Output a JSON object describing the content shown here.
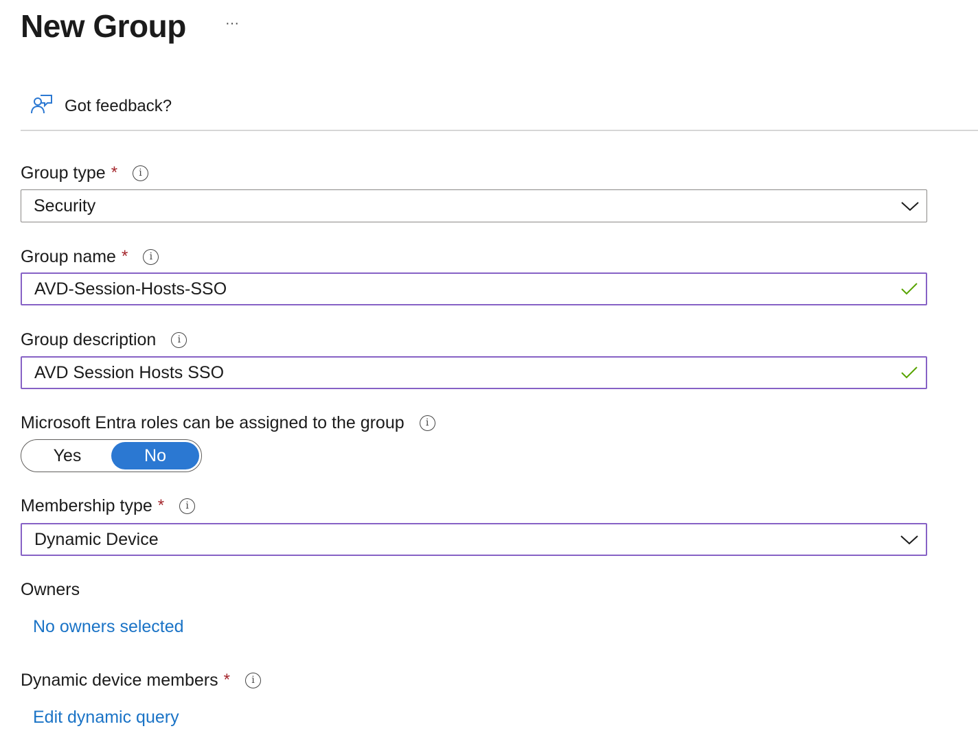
{
  "header": {
    "title": "New Group",
    "more_label": "···"
  },
  "toolbar": {
    "feedback_label": "Got feedback?"
  },
  "form": {
    "required_marker": "*",
    "info_glyph": "i",
    "group_type": {
      "label": "Group type",
      "value": "Security"
    },
    "group_name": {
      "label": "Group name",
      "value": "AVD-Session-Hosts-SSO"
    },
    "group_description": {
      "label": "Group description",
      "value": "AVD Session Hosts SSO"
    },
    "entra_roles": {
      "label": "Microsoft Entra roles can be assigned to the group",
      "options": [
        "Yes",
        "No"
      ],
      "selected": "No"
    },
    "membership_type": {
      "label": "Membership type",
      "value": "Dynamic Device"
    },
    "owners": {
      "label": "Owners",
      "link": "No owners selected"
    },
    "dynamic_members": {
      "label": "Dynamic device members",
      "link": "Edit dynamic query"
    }
  },
  "colors": {
    "accent": "#2b78d2",
    "link": "#1a73c6",
    "focus_border": "#8661c5",
    "required": "#a4262c",
    "valid_check": "#57a300"
  },
  "icons": {
    "feedback": "feedback-person-chat-icon",
    "dropdown": "chevron-down-icon",
    "valid": "checkmark-icon",
    "info": "info-icon"
  }
}
